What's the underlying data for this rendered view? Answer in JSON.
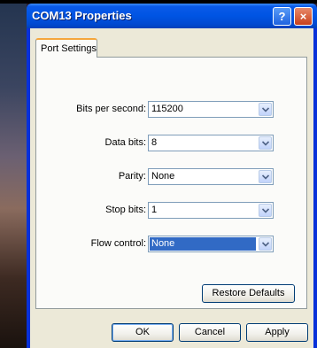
{
  "window": {
    "title": "COM13 Properties"
  },
  "title_buttons": {
    "help": "?",
    "close": "×"
  },
  "tabs": [
    {
      "label": "Port Settings"
    }
  ],
  "fields": [
    {
      "label": "Bits per second:",
      "value": "115200"
    },
    {
      "label": "Data bits:",
      "value": "8"
    },
    {
      "label": "Parity:",
      "value": "None"
    },
    {
      "label": "Stop bits:",
      "value": "1"
    },
    {
      "label": "Flow control:",
      "value": "None"
    }
  ],
  "buttons": {
    "restore": "Restore Defaults",
    "ok": "OK",
    "cancel": "Cancel",
    "apply": "Apply"
  },
  "colors": {
    "title_bar": "#0054e3",
    "selection": "#316ac5",
    "dialog_face": "#ece9d8",
    "tab_accent": "#f5a63b"
  },
  "icons": {
    "combo_arrow": "chevron-down-icon",
    "help": "help-icon",
    "close": "close-icon"
  }
}
